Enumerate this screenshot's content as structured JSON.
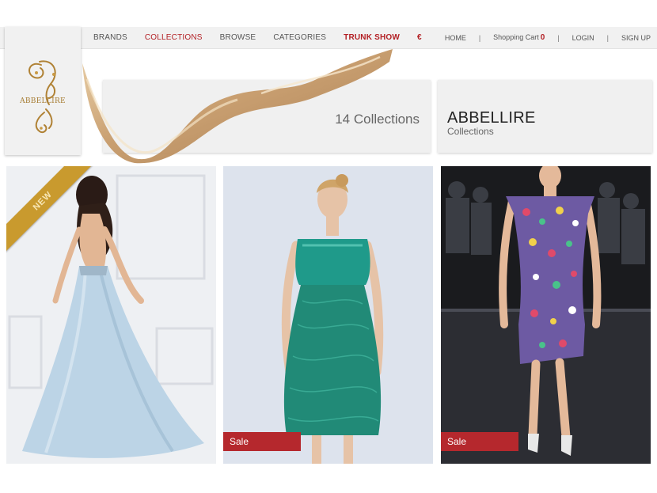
{
  "nav": {
    "items": [
      {
        "label": "BRANDS"
      },
      {
        "label": "COLLECTIONS"
      },
      {
        "label": "BROWSE"
      },
      {
        "label": "CATEGORIES"
      },
      {
        "label": "TRUNK SHOW"
      },
      {
        "label": "€"
      }
    ],
    "right": {
      "home": "HOME",
      "separator": "|",
      "cart_label": "Shopping Cart",
      "cart_count": "0",
      "login": "LOGIN",
      "signup": "SIGN UP"
    }
  },
  "logo": {
    "text": "ABBELLIRE"
  },
  "header": {
    "collections_count": "14 Collections",
    "brand_title": "ABBELLIRE",
    "brand_subtitle": "Collections"
  },
  "products": [
    {
      "badge": "NEW",
      "sale_label": ""
    },
    {
      "badge": "",
      "sale_label": "Sale"
    },
    {
      "badge": "",
      "sale_label": "Sale"
    }
  ],
  "colors": {
    "accent": "#b32025",
    "sale_bg": "#b5282d",
    "ribbon": "#c99a2e",
    "logo_gold": "#a67c32"
  }
}
